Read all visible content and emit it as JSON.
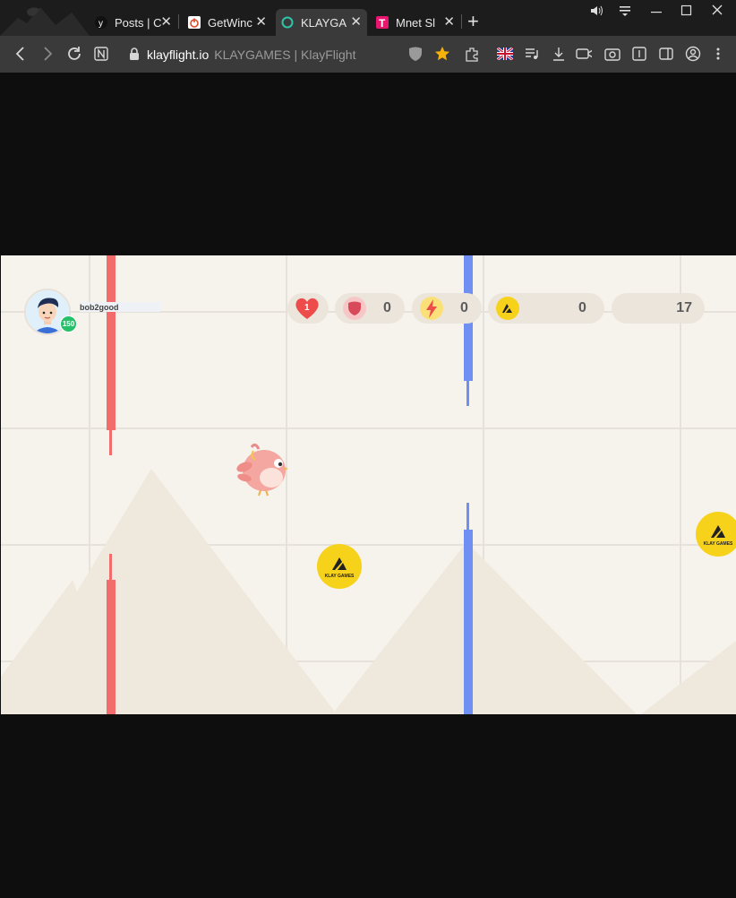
{
  "browser": {
    "tabs": [
      {
        "label": "Posts | C",
        "icon": "twitter-like-icon"
      },
      {
        "label": "GetWinc",
        "icon": "power-icon"
      },
      {
        "label": "KLAYGA",
        "icon": "circle-icon",
        "active": true
      },
      {
        "label": "Mnet Sl",
        "icon": "t-logo-icon"
      }
    ],
    "new_tab": "+",
    "url_host": "klayflight.io",
    "page_title": "KLAYGAMES | KlayFlight"
  },
  "hud": {
    "username": "bob2good",
    "level_badge": "150",
    "hearts": "1",
    "shields": "0",
    "boosts": "0",
    "coins": "0",
    "score": "17"
  },
  "coins": [
    {
      "label": "KLAY GAMES"
    },
    {
      "label": "KLAY GAMES"
    }
  ],
  "colors": {
    "pipe_red": "#f36c6c",
    "pipe_blue": "#6f8ff2",
    "coin_yellow": "#f7d21a",
    "game_bg": "#f6f2ec"
  }
}
